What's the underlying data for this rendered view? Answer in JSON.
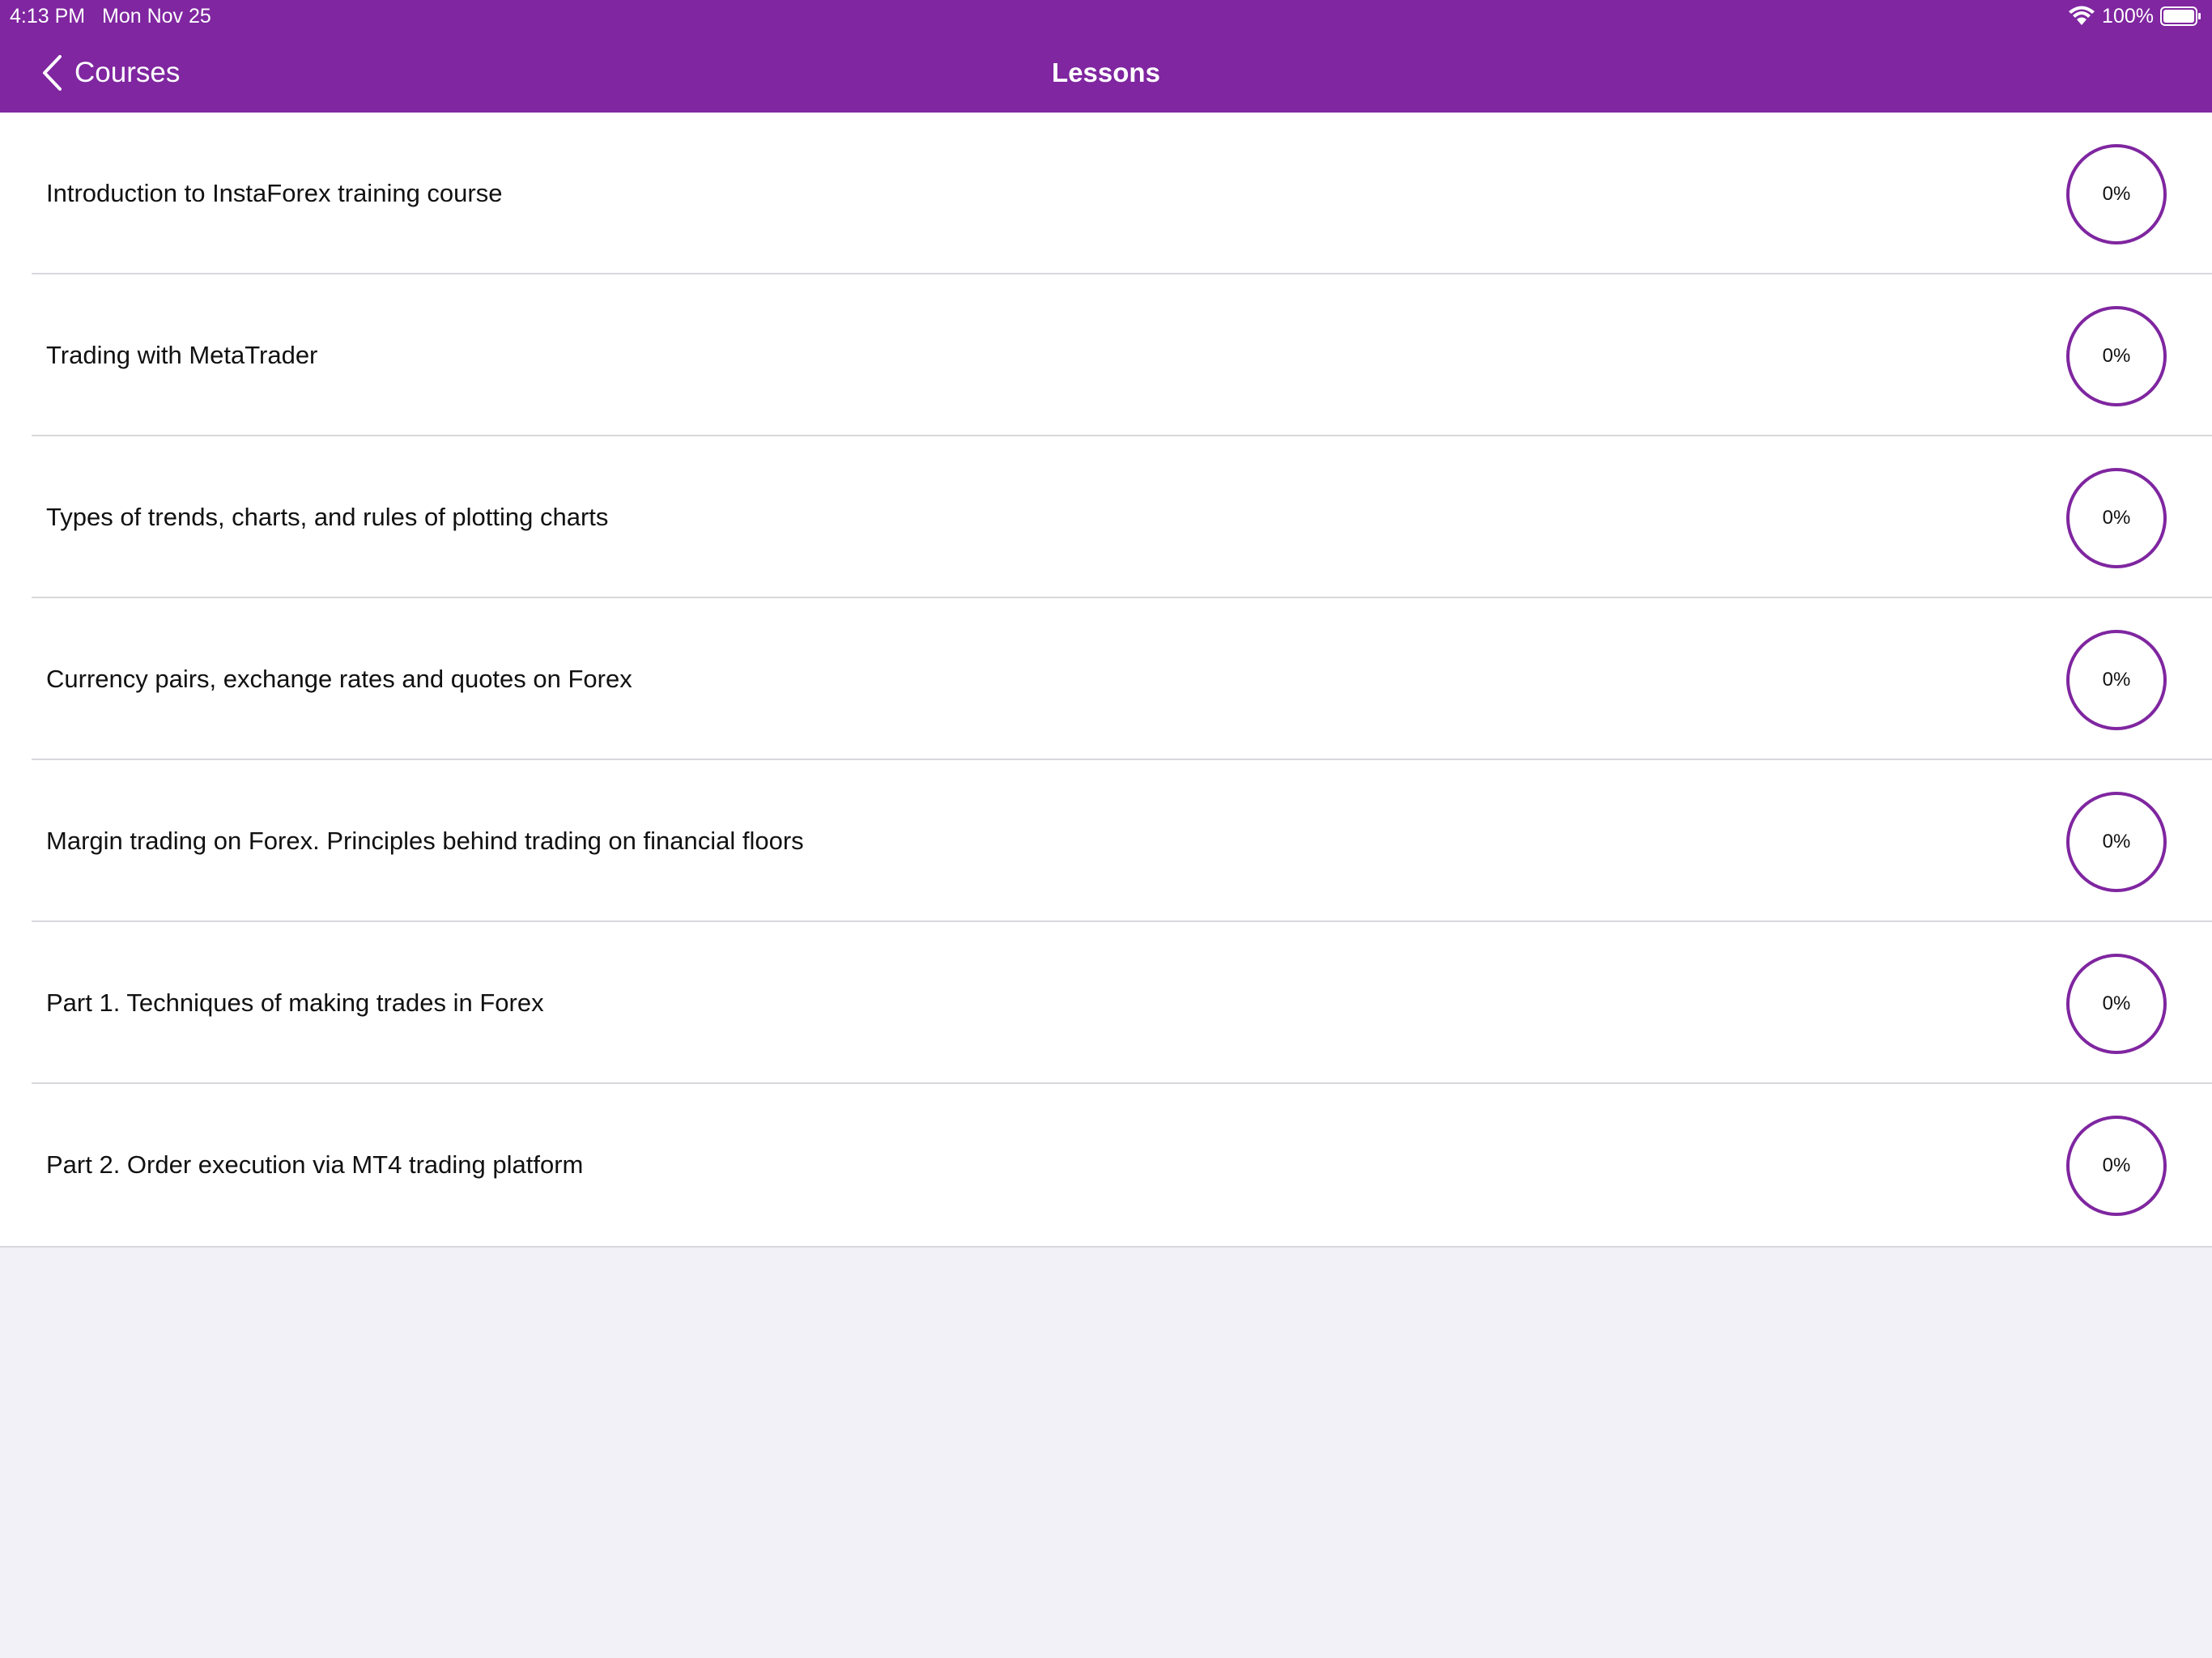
{
  "status_bar": {
    "time": "4:13 PM",
    "date": "Mon Nov 25",
    "battery": "100%",
    "wifi_icon": "wifi-icon",
    "battery_icon": "battery-icon"
  },
  "nav": {
    "back_label": "Courses",
    "back_icon": "chevron-left-icon",
    "title": "Lessons"
  },
  "colors": {
    "accent": "#7f26a0",
    "background": "#f2f1f7",
    "separator": "#d8d8dc"
  },
  "lessons": [
    {
      "title": "Introduction to InstaForex training course",
      "progress": "0%"
    },
    {
      "title": "Trading with MetaTrader",
      "progress": "0%"
    },
    {
      "title": "Types of trends, charts, and rules of plotting charts",
      "progress": "0%"
    },
    {
      "title": "Currency pairs, exchange rates and quotes on Forex",
      "progress": "0%"
    },
    {
      "title": "Margin trading on Forex. Principles behind trading on financial floors",
      "progress": "0%"
    },
    {
      "title": "Part 1. Techniques of making trades in Forex",
      "progress": "0%"
    },
    {
      "title": "Part 2. Order execution via MT4 trading platform",
      "progress": "0%"
    }
  ]
}
